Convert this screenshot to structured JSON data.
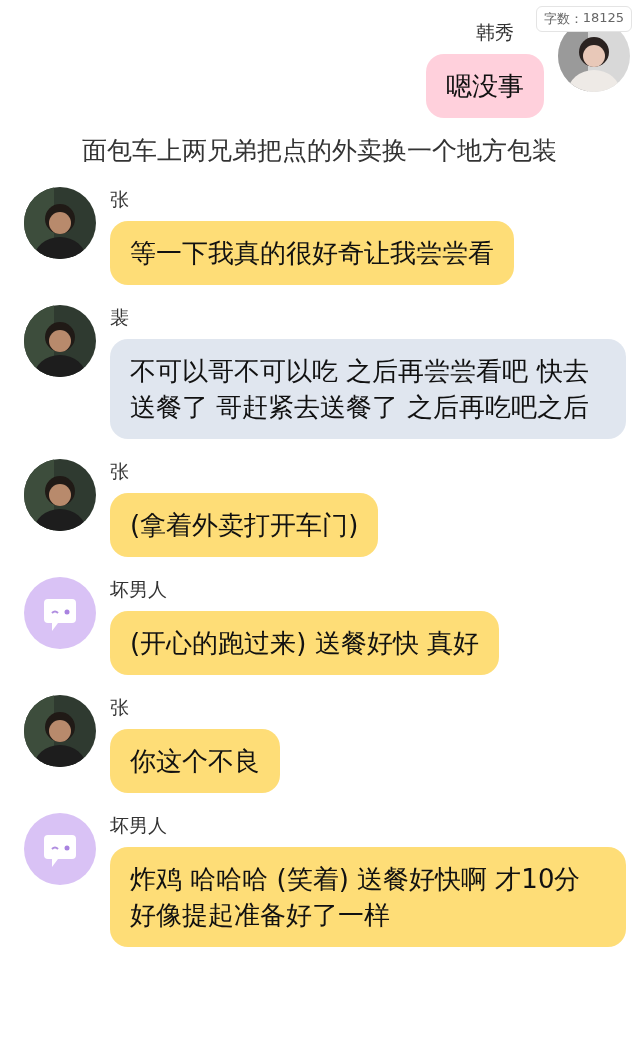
{
  "badge": {
    "label": "字数：",
    "count": "18125"
  },
  "messages": [
    {
      "kind": "self",
      "name": "韩秀",
      "color": "#ffd0dc",
      "text": "嗯没事"
    },
    {
      "kind": "narration",
      "text": "面包车上两兄弟把点的外卖换一个地方包装"
    },
    {
      "kind": "other",
      "name": "张",
      "color": "#fedd77",
      "text": "等一下我真的很好奇让我尝尝看"
    },
    {
      "kind": "other",
      "name": "裴",
      "color": "#e0e6ef",
      "text": "不可以哥不可以吃 之后再尝尝看吧 快去送餐了 哥赶紧去送餐了 之后再吃吧之后"
    },
    {
      "kind": "other",
      "name": "张",
      "color": "#fedd77",
      "text": "(拿着外卖打开车门)"
    },
    {
      "kind": "other",
      "name": "坏男人",
      "avatar": {
        "kind": "bot"
      },
      "color": "#fedd77",
      "text": "(开心的跑过来) 送餐好快 真好"
    },
    {
      "kind": "other",
      "name": "张",
      "color": "#fedd77",
      "text": "你这个不良"
    },
    {
      "kind": "other",
      "name": "坏男人",
      "avatar": {
        "kind": "bot"
      },
      "color": "#fedd77",
      "text": "炸鸡 哈哈哈 (笑着) 送餐好快啊 才10分好像提起准备好了一样"
    }
  ]
}
